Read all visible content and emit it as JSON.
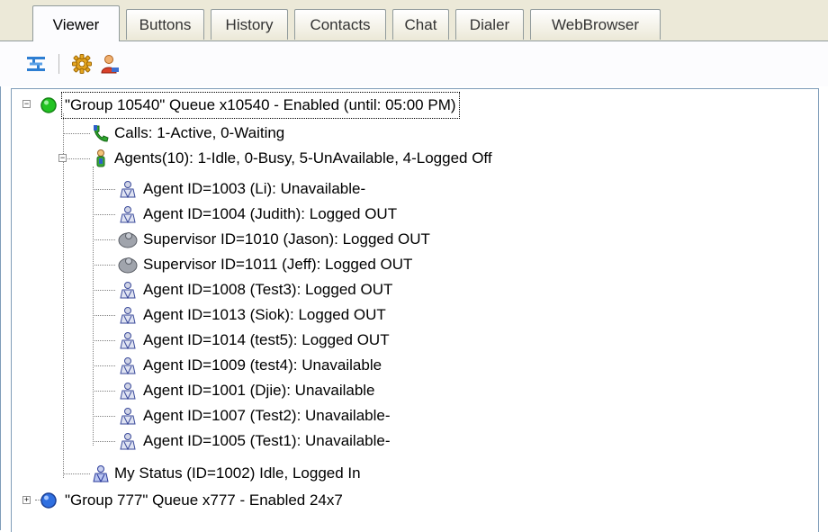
{
  "tabs": [
    {
      "label": "Viewer",
      "active": true
    },
    {
      "label": "Buttons"
    },
    {
      "label": "History"
    },
    {
      "label": "Contacts"
    },
    {
      "label": "Chat"
    },
    {
      "label": "Dialer"
    },
    {
      "label": "WebBrowser"
    }
  ],
  "toolbar": {
    "icons": [
      "toggle-lines-icon",
      "gear-icon",
      "user-icon"
    ]
  },
  "tree": {
    "group1": {
      "label": "\"Group 10540\" Queue x10540 - Enabled (until: 05:00 PM)",
      "status_color": "#22c322",
      "expanded": true,
      "calls": "Calls: 1-Active, 0-Waiting",
      "agents_header": "Agents(10): 1-Idle, 0-Busy, 5-UnAvailable, 4-Logged Off",
      "agents": [
        {
          "label": "Agent ID=1003 (Li): Unavailable-",
          "kind": "agent"
        },
        {
          "label": "Agent ID=1004 (Judith): Logged OUT",
          "kind": "agent"
        },
        {
          "label": "Supervisor ID=1010 (Jason): Logged OUT",
          "kind": "supervisor"
        },
        {
          "label": "Supervisor ID=1011 (Jeff): Logged OUT",
          "kind": "supervisor"
        },
        {
          "label": "Agent ID=1008 (Test3): Logged OUT",
          "kind": "agent"
        },
        {
          "label": "Agent ID=1013 (Siok): Logged OUT",
          "kind": "agent"
        },
        {
          "label": "Agent ID=1014 (test5): Logged OUT",
          "kind": "agent"
        },
        {
          "label": "Agent ID=1009 (test4): Unavailable",
          "kind": "agent"
        },
        {
          "label": "Agent ID=1001 (Djie): Unavailable",
          "kind": "agent"
        },
        {
          "label": "Agent ID=1007 (Test2): Unavailable-",
          "kind": "agent"
        },
        {
          "label": "Agent ID=1005 (Test1): Unavailable-",
          "kind": "agent"
        }
      ],
      "my_status": "My Status (ID=1002) Idle, Logged In"
    },
    "group2": {
      "label": "\"Group 777\" Queue x777 - Enabled 24x7",
      "status_color": "#2f6fe0",
      "expanded": false
    }
  }
}
